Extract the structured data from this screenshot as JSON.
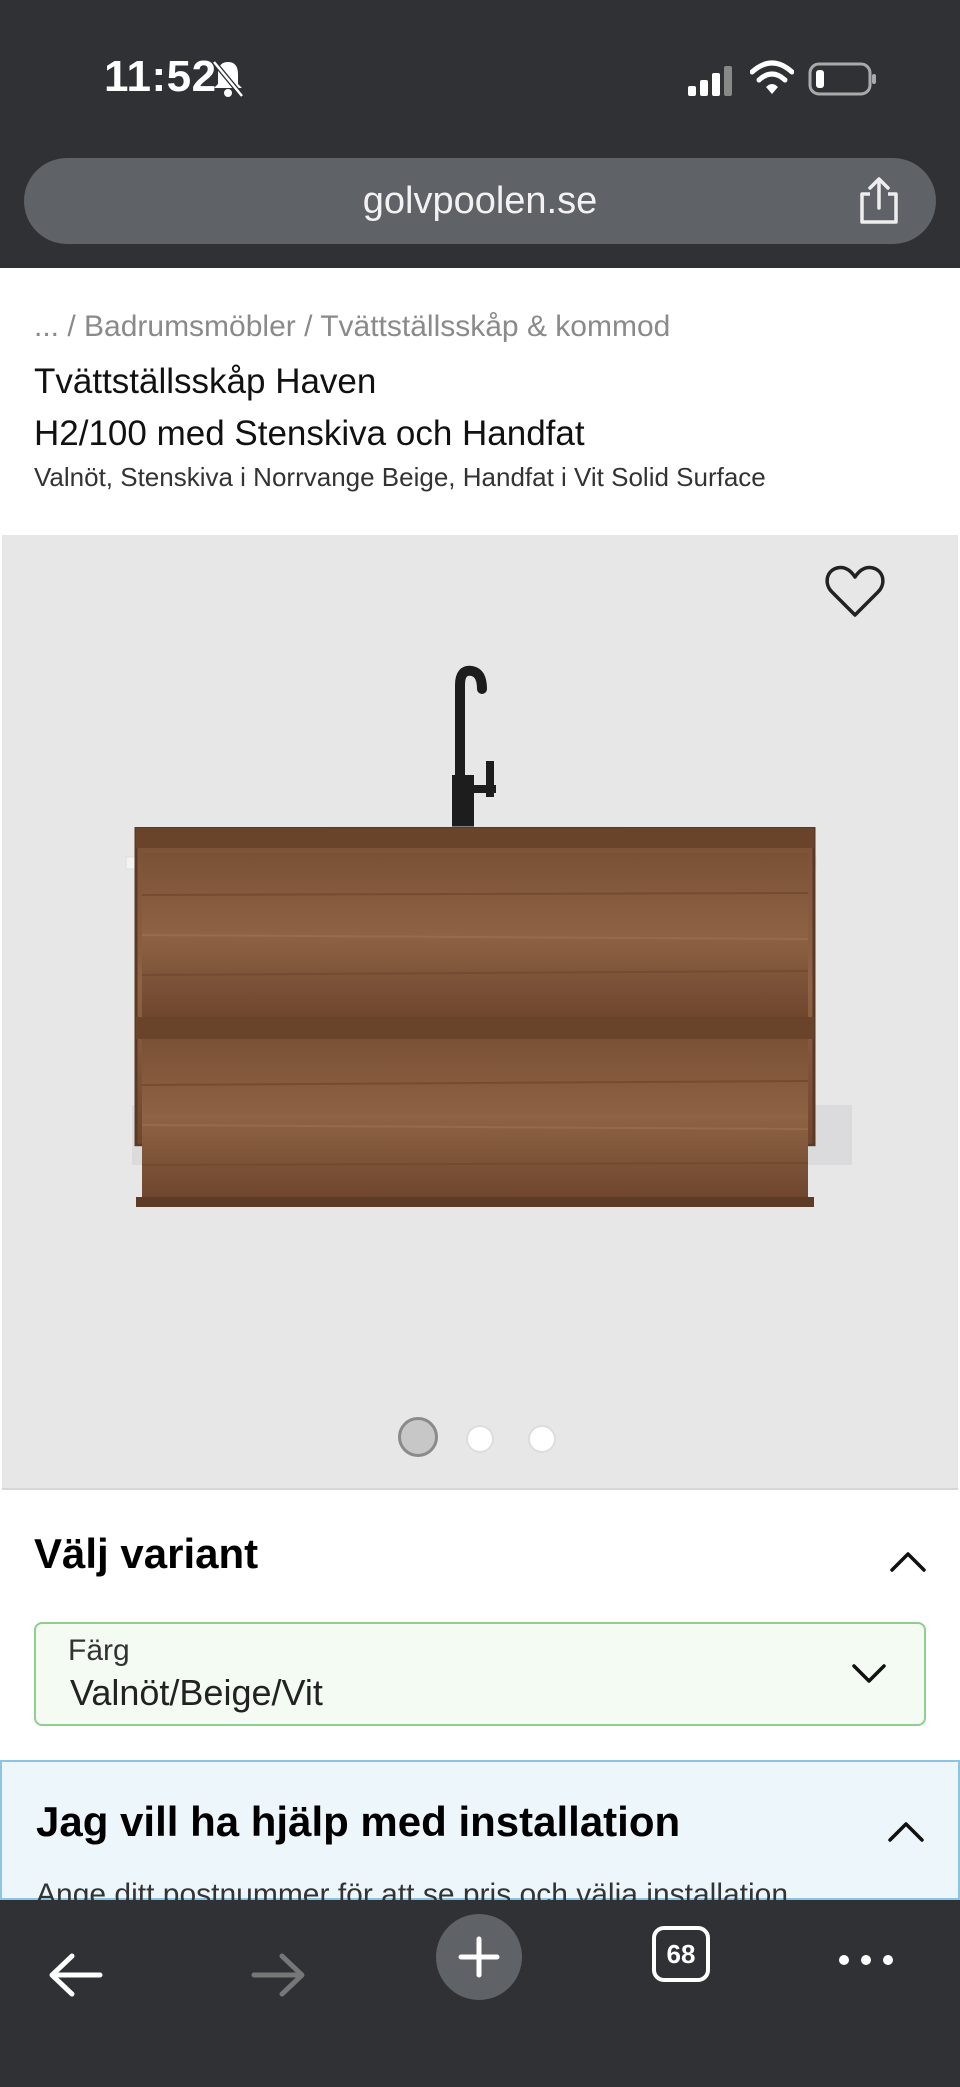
{
  "status_bar": {
    "time": "11:52"
  },
  "browser": {
    "url": "golvpoolen.se",
    "tab_count": "68"
  },
  "page": {
    "breadcrumb": "... / Badrumsmöbler / Tvättställsskåp & kommod",
    "title_line1": "Tvättställsskåp Haven",
    "title_line2": "H2/100 med Stenskiva och Handfat",
    "subtitle": "Valnöt, Stenskiva i Norrvange Beige, Handfat i Vit Solid Surface",
    "gallery": {
      "total_images": 3,
      "active_index": 0
    }
  },
  "variant": {
    "heading": "Välj variant",
    "select_label": "Färg",
    "select_value": "Valnöt/Beige/Vit"
  },
  "installation": {
    "heading": "Jag vill ha hjälp med installation",
    "text": "Ange ditt postnummer för att se pris och välja installation"
  },
  "colors": {
    "chrome": "#2f3135",
    "select_border": "#8fce8f",
    "install_border": "#8bc5e3"
  }
}
